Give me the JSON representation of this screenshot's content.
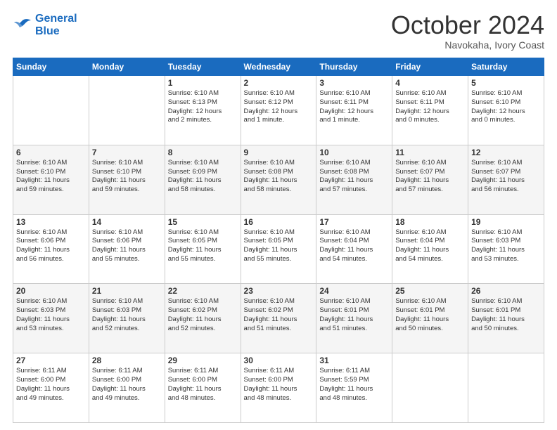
{
  "header": {
    "logo_line1": "General",
    "logo_line2": "Blue",
    "month": "October 2024",
    "location": "Navokaha, Ivory Coast"
  },
  "weekdays": [
    "Sunday",
    "Monday",
    "Tuesday",
    "Wednesday",
    "Thursday",
    "Friday",
    "Saturday"
  ],
  "weeks": [
    [
      {
        "day": "",
        "content": ""
      },
      {
        "day": "",
        "content": ""
      },
      {
        "day": "1",
        "content": "Sunrise: 6:10 AM\nSunset: 6:13 PM\nDaylight: 12 hours\nand 2 minutes."
      },
      {
        "day": "2",
        "content": "Sunrise: 6:10 AM\nSunset: 6:12 PM\nDaylight: 12 hours\nand 1 minute."
      },
      {
        "day": "3",
        "content": "Sunrise: 6:10 AM\nSunset: 6:11 PM\nDaylight: 12 hours\nand 1 minute."
      },
      {
        "day": "4",
        "content": "Sunrise: 6:10 AM\nSunset: 6:11 PM\nDaylight: 12 hours\nand 0 minutes."
      },
      {
        "day": "5",
        "content": "Sunrise: 6:10 AM\nSunset: 6:10 PM\nDaylight: 12 hours\nand 0 minutes."
      }
    ],
    [
      {
        "day": "6",
        "content": "Sunrise: 6:10 AM\nSunset: 6:10 PM\nDaylight: 11 hours\nand 59 minutes."
      },
      {
        "day": "7",
        "content": "Sunrise: 6:10 AM\nSunset: 6:10 PM\nDaylight: 11 hours\nand 59 minutes."
      },
      {
        "day": "8",
        "content": "Sunrise: 6:10 AM\nSunset: 6:09 PM\nDaylight: 11 hours\nand 58 minutes."
      },
      {
        "day": "9",
        "content": "Sunrise: 6:10 AM\nSunset: 6:08 PM\nDaylight: 11 hours\nand 58 minutes."
      },
      {
        "day": "10",
        "content": "Sunrise: 6:10 AM\nSunset: 6:08 PM\nDaylight: 11 hours\nand 57 minutes."
      },
      {
        "day": "11",
        "content": "Sunrise: 6:10 AM\nSunset: 6:07 PM\nDaylight: 11 hours\nand 57 minutes."
      },
      {
        "day": "12",
        "content": "Sunrise: 6:10 AM\nSunset: 6:07 PM\nDaylight: 11 hours\nand 56 minutes."
      }
    ],
    [
      {
        "day": "13",
        "content": "Sunrise: 6:10 AM\nSunset: 6:06 PM\nDaylight: 11 hours\nand 56 minutes."
      },
      {
        "day": "14",
        "content": "Sunrise: 6:10 AM\nSunset: 6:06 PM\nDaylight: 11 hours\nand 55 minutes."
      },
      {
        "day": "15",
        "content": "Sunrise: 6:10 AM\nSunset: 6:05 PM\nDaylight: 11 hours\nand 55 minutes."
      },
      {
        "day": "16",
        "content": "Sunrise: 6:10 AM\nSunset: 6:05 PM\nDaylight: 11 hours\nand 55 minutes."
      },
      {
        "day": "17",
        "content": "Sunrise: 6:10 AM\nSunset: 6:04 PM\nDaylight: 11 hours\nand 54 minutes."
      },
      {
        "day": "18",
        "content": "Sunrise: 6:10 AM\nSunset: 6:04 PM\nDaylight: 11 hours\nand 54 minutes."
      },
      {
        "day": "19",
        "content": "Sunrise: 6:10 AM\nSunset: 6:03 PM\nDaylight: 11 hours\nand 53 minutes."
      }
    ],
    [
      {
        "day": "20",
        "content": "Sunrise: 6:10 AM\nSunset: 6:03 PM\nDaylight: 11 hours\nand 53 minutes."
      },
      {
        "day": "21",
        "content": "Sunrise: 6:10 AM\nSunset: 6:03 PM\nDaylight: 11 hours\nand 52 minutes."
      },
      {
        "day": "22",
        "content": "Sunrise: 6:10 AM\nSunset: 6:02 PM\nDaylight: 11 hours\nand 52 minutes."
      },
      {
        "day": "23",
        "content": "Sunrise: 6:10 AM\nSunset: 6:02 PM\nDaylight: 11 hours\nand 51 minutes."
      },
      {
        "day": "24",
        "content": "Sunrise: 6:10 AM\nSunset: 6:01 PM\nDaylight: 11 hours\nand 51 minutes."
      },
      {
        "day": "25",
        "content": "Sunrise: 6:10 AM\nSunset: 6:01 PM\nDaylight: 11 hours\nand 50 minutes."
      },
      {
        "day": "26",
        "content": "Sunrise: 6:10 AM\nSunset: 6:01 PM\nDaylight: 11 hours\nand 50 minutes."
      }
    ],
    [
      {
        "day": "27",
        "content": "Sunrise: 6:11 AM\nSunset: 6:00 PM\nDaylight: 11 hours\nand 49 minutes."
      },
      {
        "day": "28",
        "content": "Sunrise: 6:11 AM\nSunset: 6:00 PM\nDaylight: 11 hours\nand 49 minutes."
      },
      {
        "day": "29",
        "content": "Sunrise: 6:11 AM\nSunset: 6:00 PM\nDaylight: 11 hours\nand 48 minutes."
      },
      {
        "day": "30",
        "content": "Sunrise: 6:11 AM\nSunset: 6:00 PM\nDaylight: 11 hours\nand 48 minutes."
      },
      {
        "day": "31",
        "content": "Sunrise: 6:11 AM\nSunset: 5:59 PM\nDaylight: 11 hours\nand 48 minutes."
      },
      {
        "day": "",
        "content": ""
      },
      {
        "day": "",
        "content": ""
      }
    ]
  ]
}
